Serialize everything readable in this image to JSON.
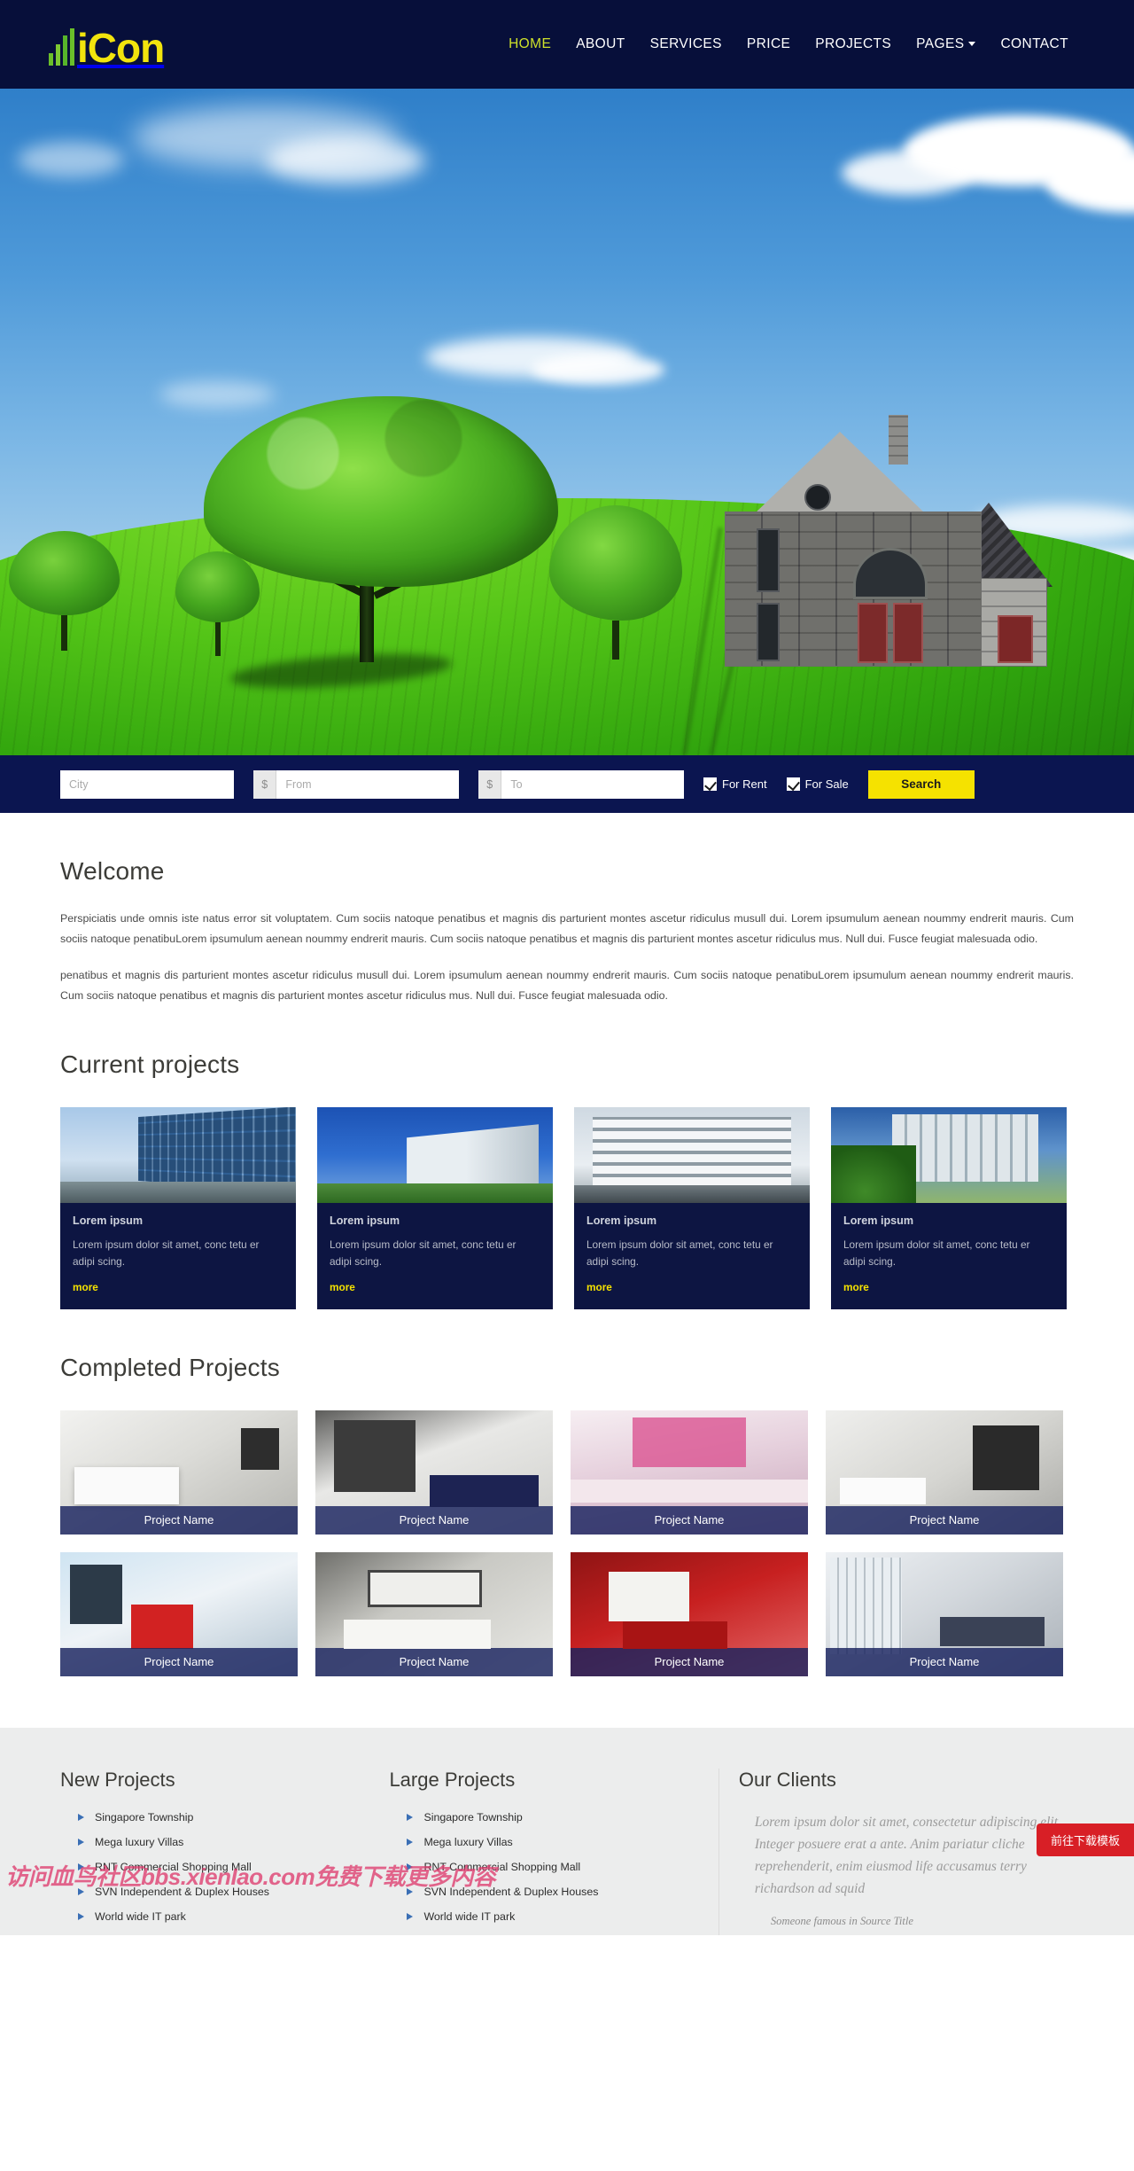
{
  "brand": {
    "name": "iCon",
    "logo_icon": "bar-chart-logo-icon",
    "accent": "#f2e40d",
    "bar_color": "#6abf2a"
  },
  "nav": {
    "items": [
      {
        "label": "HOME",
        "active": true
      },
      {
        "label": "ABOUT",
        "active": false
      },
      {
        "label": "SERVICES",
        "active": false
      },
      {
        "label": "PRICE",
        "active": false
      },
      {
        "label": "PROJECTS",
        "active": false
      },
      {
        "label": "PAGES",
        "active": false,
        "has_caret": true
      },
      {
        "label": "CONTACT",
        "active": false
      }
    ],
    "active_color": "#cde02a"
  },
  "hero": {
    "alt": "green field with tree and house under blue sky"
  },
  "search": {
    "city_placeholder": "City",
    "from_placeholder": "From",
    "to_placeholder": "To",
    "currency_symbol": "$",
    "city_value": "",
    "from_value": "",
    "to_value": "",
    "for_rent_label": "For Rent",
    "for_rent_checked": true,
    "for_sale_label": "For Sale",
    "for_sale_checked": true,
    "button_label": "Search",
    "button_color": "#f5e200",
    "bar_color": "#0b1550"
  },
  "welcome": {
    "title": "Welcome",
    "paragraph1": "Perspiciatis unde omnis iste natus error sit voluptatem. Cum sociis natoque penatibus et magnis dis parturient montes ascetur ridiculus musull dui. Lorem ipsumulum aenean noummy endrerit mauris. Cum sociis natoque penatibuLorem ipsumulum aenean noummy endrerit mauris. Cum sociis natoque penatibus et magnis dis parturient montes ascetur ridiculus mus. Null dui. Fusce feugiat malesuada odio.",
    "paragraph2": "penatibus et magnis dis parturient montes ascetur ridiculus musull dui. Lorem ipsumulum aenean noummy endrerit mauris. Cum sociis natoque penatibuLorem ipsumulum aenean noummy endrerit mauris. Cum sociis natoque penatibus et magnis dis parturient montes ascetur ridiculus mus. Null dui. Fusce feugiat malesuada odio."
  },
  "current_projects": {
    "title": "Current projects",
    "cards": [
      {
        "title": "Lorem ipsum",
        "text": "Lorem ipsum dolor sit amet, conc tetu er adipi scing.",
        "more_label": "more",
        "thumb": "glass-office-building"
      },
      {
        "title": "Lorem ipsum",
        "text": "Lorem ipsum dolor sit amet, conc tetu er adipi scing.",
        "more_label": "more",
        "thumb": "white-modern-building"
      },
      {
        "title": "Lorem ipsum",
        "text": "Lorem ipsum dolor sit amet, conc tetu er adipi scing.",
        "more_label": "more",
        "thumb": "office-block-facade"
      },
      {
        "title": "Lorem ipsum",
        "text": "Lorem ipsum dolor sit amet, conc tetu er adipi scing.",
        "more_label": "more",
        "thumb": "mixed-use-complex"
      }
    ]
  },
  "completed_projects": {
    "title": "Completed Projects",
    "tiles": [
      {
        "caption": "Project Name",
        "art": "white-living-room"
      },
      {
        "caption": "Project Name",
        "art": "dark-bedroom"
      },
      {
        "caption": "Project Name",
        "art": "pink-ceiling-room"
      },
      {
        "caption": "Project Name",
        "art": "grey-tv-room"
      },
      {
        "caption": "Project Name",
        "art": "blue-lounge-red-chair"
      },
      {
        "caption": "Project Name",
        "art": "grey-sofa-wall-art"
      },
      {
        "caption": "Project Name",
        "art": "red-sofa-room"
      },
      {
        "caption": "Project Name",
        "art": "white-blinds-bedroom"
      }
    ]
  },
  "footer": {
    "columns": [
      {
        "title": "New Projects",
        "links": [
          "Singapore Township",
          "Mega luxury Villas",
          "RNT Commercial Shopping Mall",
          "SVN Independent & Duplex Houses",
          "World wide IT park"
        ]
      },
      {
        "title": "Large Projects",
        "links": [
          "Singapore Township",
          "Mega luxury Villas",
          "RNT Commercial Shopping Mall",
          "SVN Independent & Duplex Houses",
          "World wide IT park"
        ]
      }
    ],
    "clients": {
      "title": "Our Clients",
      "quote": "Lorem ipsum dolor sit amet, consectetur adipiscing elit. Integer posuere erat a ante. Anim pariatur cliche reprehenderit, enim eiusmod life accusamus terry richardson ad squid",
      "cite": "Someone famous in Source Title"
    }
  },
  "overlay": {
    "watermark": "访问血鸟社区bbs.xienIao.com免费下载更多内容",
    "download_button": "前往下载模板",
    "download_color": "#d81f26"
  }
}
